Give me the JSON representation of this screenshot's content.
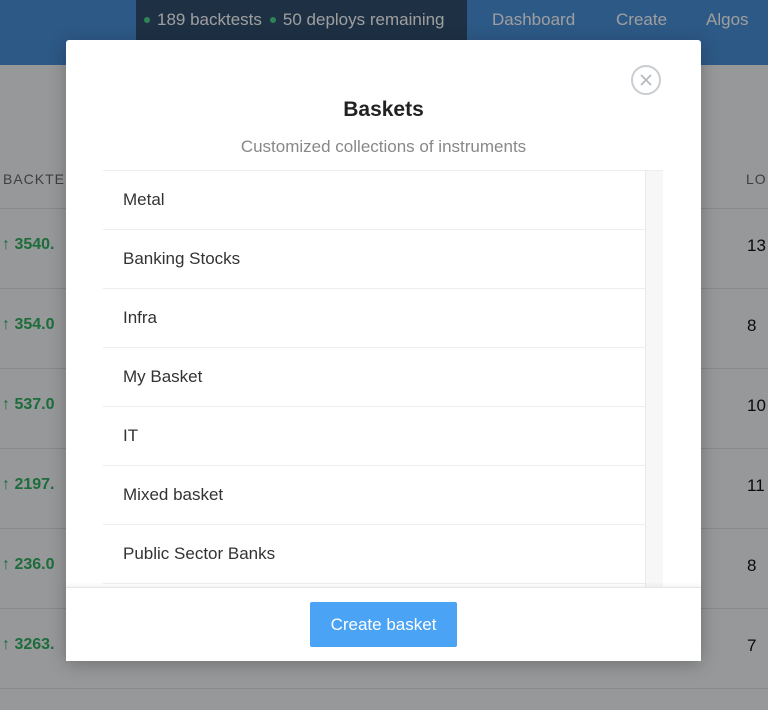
{
  "nav": {
    "backtests": "189 backtests",
    "deploys": "50 deploys remaining",
    "links": [
      "Dashboard",
      "Create",
      "Algos"
    ]
  },
  "background_table": {
    "left_header": "BACKTE",
    "right_header": "LO",
    "rows": [
      {
        "value": "↑ 3540.",
        "count": "13"
      },
      {
        "value": "↑ 354.0",
        "count": "8"
      },
      {
        "value": "↑ 537.0",
        "count": "10"
      },
      {
        "value": "↑ 2197.",
        "count": "11"
      },
      {
        "value": "↑ 236.0",
        "count": "8"
      },
      {
        "value": "↑ 3263.",
        "count": "7"
      }
    ]
  },
  "modal": {
    "title": "Baskets",
    "subtitle": "Customized collections of instruments",
    "items": [
      "Metal",
      "Banking Stocks",
      "Infra",
      "My Basket",
      "IT",
      "Mixed basket",
      "Public Sector Banks"
    ],
    "create_label": "Create basket"
  },
  "colors": {
    "nav": "#4a90d9",
    "pill": "#2f4e6e",
    "positive": "#2fae5f",
    "button": "#4aa3f5"
  },
  "icons": {
    "close": "close-icon"
  }
}
